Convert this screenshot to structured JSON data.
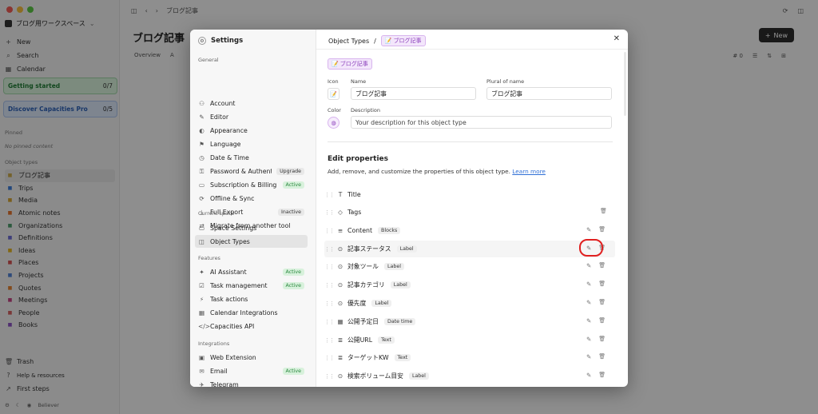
{
  "sidebar": {
    "workspace": "ブログ用ワークスペース",
    "top": [
      {
        "icon": "plus-icon",
        "glyph": "+",
        "label": "New"
      },
      {
        "icon": "search-icon",
        "glyph": "⌕",
        "label": "Search"
      },
      {
        "icon": "calendar-icon",
        "glyph": "▦",
        "label": "Calendar"
      }
    ],
    "getting_started": {
      "label": "Getting started",
      "count": "0/7"
    },
    "discover": {
      "label": "Discover Capacities Pro",
      "count": "0/5"
    },
    "pinned_header": "Pinned",
    "pinned_empty": "No pinned content",
    "object_types_header": "Object types",
    "object_types": [
      {
        "label": "ブログ記事",
        "color": "#c9a84a"
      },
      {
        "label": "Trips",
        "color": "#3a7bd5"
      },
      {
        "label": "Media",
        "color": "#d0a030"
      },
      {
        "label": "Atomic notes",
        "color": "#e0702a"
      },
      {
        "label": "Organizations",
        "color": "#4a9a6a"
      },
      {
        "label": "Definitions",
        "color": "#6a6ad0"
      },
      {
        "label": "Ideas",
        "color": "#e0b020"
      },
      {
        "label": "Places",
        "color": "#d05050"
      },
      {
        "label": "Projects",
        "color": "#5080d0"
      },
      {
        "label": "Quotes",
        "color": "#e08030"
      },
      {
        "label": "Meetings",
        "color": "#c04080"
      },
      {
        "label": "People",
        "color": "#d06060"
      },
      {
        "label": "Books",
        "color": "#8a50c0"
      }
    ],
    "bottom": [
      {
        "glyph": "🗑",
        "label": "Trash"
      },
      {
        "glyph": "?",
        "label": "Help & resources"
      },
      {
        "glyph": "↗",
        "label": "First steps"
      }
    ],
    "user": "Believer"
  },
  "main": {
    "title": "ブログ記事",
    "tabs": [
      "Overview",
      "A"
    ],
    "new_label": "New",
    "toolbar_count": "# 0"
  },
  "settings": {
    "title": "Settings",
    "groups": {
      "general": "General",
      "current_space": "Current space",
      "features": "Features",
      "integrations": "Integrations"
    },
    "general_items": [
      {
        "glyph": "⚇",
        "label": "Account",
        "badge": "",
        "badge_type": ""
      },
      {
        "glyph": "✎",
        "label": "Editor",
        "badge": "",
        "badge_type": ""
      },
      {
        "glyph": "◐",
        "label": "Appearance",
        "badge": "",
        "badge_type": ""
      },
      {
        "glyph": "⚑",
        "label": "Language",
        "badge": "",
        "badge_type": ""
      },
      {
        "glyph": "◷",
        "label": "Date & Time",
        "badge": "",
        "badge_type": ""
      },
      {
        "glyph": "⚿",
        "label": "Password & Authenti...",
        "badge": "Upgrade",
        "badge_type": "gray"
      },
      {
        "glyph": "▭",
        "label": "Subscription & Billing",
        "badge": "Active",
        "badge_type": "green"
      },
      {
        "glyph": "⟳",
        "label": "Offline & Sync",
        "badge": "",
        "badge_type": ""
      },
      {
        "glyph": "⤓",
        "label": "Full Export",
        "badge": "Inactive",
        "badge_type": "gray"
      },
      {
        "glyph": "⇄",
        "label": "Migrate from another tool",
        "badge": "",
        "badge_type": ""
      }
    ],
    "space_items": [
      {
        "glyph": "▭",
        "label": "Space Settings"
      },
      {
        "glyph": "◫",
        "label": "Object Types"
      }
    ],
    "feature_items": [
      {
        "glyph": "✦",
        "label": "AI Assistant",
        "badge": "Active"
      },
      {
        "glyph": "☑",
        "label": "Task management",
        "badge": "Active"
      },
      {
        "glyph": "⚡",
        "label": "Task actions",
        "badge": ""
      },
      {
        "glyph": "▦",
        "label": "Calendar Integrations",
        "badge": ""
      },
      {
        "glyph": "</>",
        "label": "Capacities API",
        "badge": ""
      }
    ],
    "integration_items": [
      {
        "glyph": "▣",
        "label": "Web Extension",
        "badge": ""
      },
      {
        "glyph": "✉",
        "label": "Email",
        "badge": "Active"
      },
      {
        "glyph": "✈",
        "label": "Telegram",
        "badge": ""
      }
    ]
  },
  "object_type": {
    "breadcrumb_root": "Object Types",
    "breadcrumb_sep": "/",
    "name_tag": "ブログ記事",
    "icon_label": "Icon",
    "name_label": "Name",
    "name_value": "ブログ記事",
    "plural_label": "Plural of name",
    "plural_value": "ブログ記事",
    "color_label": "Color",
    "description_label": "Description",
    "description_placeholder": "Your description for this object type",
    "edit_heading": "Edit properties",
    "edit_desc": "Add, remove, and customize the properties of this object type.",
    "learn_more": "Learn more",
    "properties": [
      {
        "glyph": "T",
        "icon": "text-type-icon",
        "name": "Title",
        "type": "",
        "actions": "none"
      },
      {
        "glyph": "◇",
        "icon": "tag-icon",
        "name": "Tags",
        "type": "",
        "actions": "trash"
      },
      {
        "glyph": "≡",
        "icon": "blocks-icon",
        "name": "Content",
        "type": "Blocks",
        "actions": "both"
      },
      {
        "glyph": "⊙",
        "icon": "label-icon",
        "name": "記事ステータス",
        "type": "Label",
        "actions": "both"
      },
      {
        "glyph": "⊙",
        "icon": "label-icon",
        "name": "対象ツール",
        "type": "Label",
        "actions": "both"
      },
      {
        "glyph": "⊙",
        "icon": "label-icon",
        "name": "記事カテゴリ",
        "type": "Label",
        "actions": "both"
      },
      {
        "glyph": "⊙",
        "icon": "label-icon",
        "name": "優先度",
        "type": "Label",
        "actions": "both"
      },
      {
        "glyph": "▦",
        "icon": "calendar-icon",
        "name": "公開予定日",
        "type": "Date time",
        "actions": "both"
      },
      {
        "glyph": "≣",
        "icon": "text-icon",
        "name": "公開URL",
        "type": "Text",
        "actions": "both"
      },
      {
        "glyph": "≣",
        "icon": "text-icon",
        "name": "ターゲットKW",
        "type": "Text",
        "actions": "both"
      },
      {
        "glyph": "⊙",
        "icon": "label-icon",
        "name": "検索ボリューム目安",
        "type": "Label",
        "actions": "both"
      }
    ]
  }
}
